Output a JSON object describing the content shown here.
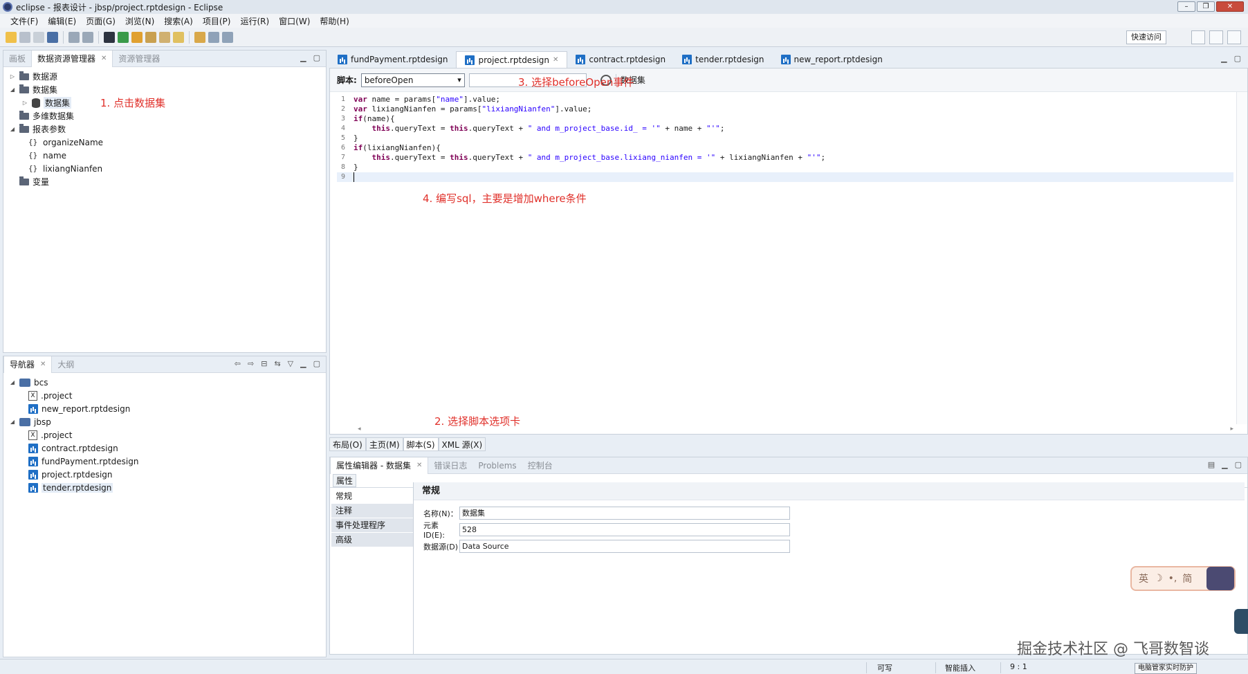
{
  "window": {
    "title": "eclipse - 报表设计 - jbsp/project.rptdesign - Eclipse",
    "controls": [
      "–",
      "❐",
      "✕"
    ]
  },
  "menu": [
    "文件(F)",
    "编辑(E)",
    "页面(G)",
    "浏览(N)",
    "搜索(A)",
    "项目(P)",
    "运行(R)",
    "窗口(W)",
    "帮助(H)"
  ],
  "toolbar": {
    "quick_access": "快速访问"
  },
  "left_panel": {
    "tabs": [
      "画板",
      "数据资源管理器",
      "资源管理器"
    ],
    "active_tab": "数据资源管理器",
    "tree": {
      "datasource": "数据源",
      "datasets": "数据集",
      "dataset_item": "数据集",
      "cube": "多维数据集",
      "params": "报表参数",
      "param_items": [
        "organizeName",
        "name",
        "lixiangNianfen"
      ],
      "variables": "变量"
    }
  },
  "nav_panel": {
    "tabs": [
      "导航器",
      "大纲"
    ],
    "projects": [
      {
        "name": "bcs",
        "files": [
          ".project",
          "new_report.rptdesign"
        ]
      },
      {
        "name": "jbsp",
        "files": [
          ".project",
          "contract.rptdesign",
          "fundPayment.rptdesign",
          "project.rptdesign",
          "tender.rptdesign"
        ]
      }
    ]
  },
  "editor": {
    "tabs": [
      "fundPayment.rptdesign",
      "project.rptdesign",
      "contract.rptdesign",
      "tender.rptdesign",
      "new_report.rptdesign"
    ],
    "active_tab": "project.rptdesign",
    "script_label": "脚本:",
    "script_event": "beforeOpen",
    "dataset_label": "数据集",
    "cursor_line": 9,
    "bottom_tabs": [
      "布局(O)",
      "主页(M)",
      "脚本(S)",
      "XML 源(X)"
    ],
    "active_bottom_tab": "脚本(S)"
  },
  "annotations": {
    "step1": "1. 点击数据集",
    "step2": "2. 选择脚本选项卡",
    "step3": "3. 选择beforeOpen事件",
    "step4": "4. 编写sql，主要是增加where条件"
  },
  "props_panel": {
    "tabs": [
      "属性编辑器 - 数据集",
      "错误日志",
      "Problems",
      "控制台"
    ],
    "sub_tab": "属性",
    "categories": [
      "常规",
      "注释",
      "事件处理程序",
      "高级"
    ],
    "section_title": "常规",
    "fields": [
      {
        "label": "名称(N)：",
        "value": "数据集"
      },
      {
        "label": "元素 ID(E):",
        "value": "528"
      },
      {
        "label": "数据源(D)",
        "value": "Data Source"
      }
    ]
  },
  "statusbar": {
    "writable": "可写",
    "insert_mode": "智能插入",
    "position": "9 : 1",
    "tray_tip": "电脑管家实时防护"
  },
  "ime": {
    "lang": "英",
    "mode": "简"
  },
  "watermark": "掘金技术社区 @ 飞哥数智谈",
  "colors": {
    "annotation": "#e0302a",
    "keyword": "#7f0055",
    "string": "#2a00ff",
    "accent": "#1f6fc5"
  }
}
